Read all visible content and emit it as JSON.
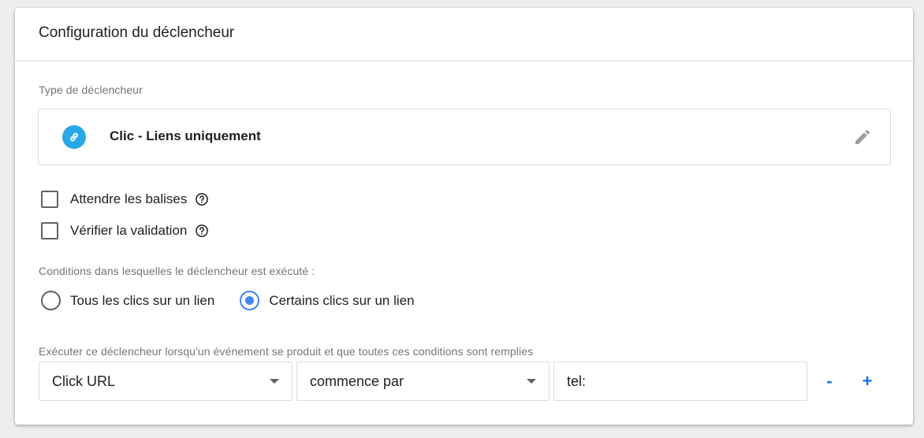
{
  "card": {
    "title": "Configuration du déclencheur"
  },
  "trigger_type": {
    "label": "Type de déclencheur",
    "name": "Clic - Liens uniquement",
    "icon": "link-icon",
    "icon_color": "#29a8e8"
  },
  "options": {
    "wait_for_tags": {
      "label": "Attendre les balises",
      "checked": false
    },
    "check_validation": {
      "label": "Vérifier la validation",
      "checked": false
    }
  },
  "conditions": {
    "label": "Conditions dans lesquelles le déclencheur est exécuté :",
    "all_clicks": {
      "label": "Tous les clics sur un lien",
      "selected": false
    },
    "some_clicks": {
      "label": "Certains clics sur un lien",
      "selected": true
    }
  },
  "filter": {
    "label": "Exécuter ce déclencheur lorsqu'un événement se produit et que toutes ces conditions sont remplies",
    "variable": "Click URL",
    "operator": "commence par",
    "value": "tel:",
    "remove_label": "-",
    "add_label": "+"
  },
  "colors": {
    "accent": "#4285f4",
    "link_blue": "#1a73e8"
  }
}
